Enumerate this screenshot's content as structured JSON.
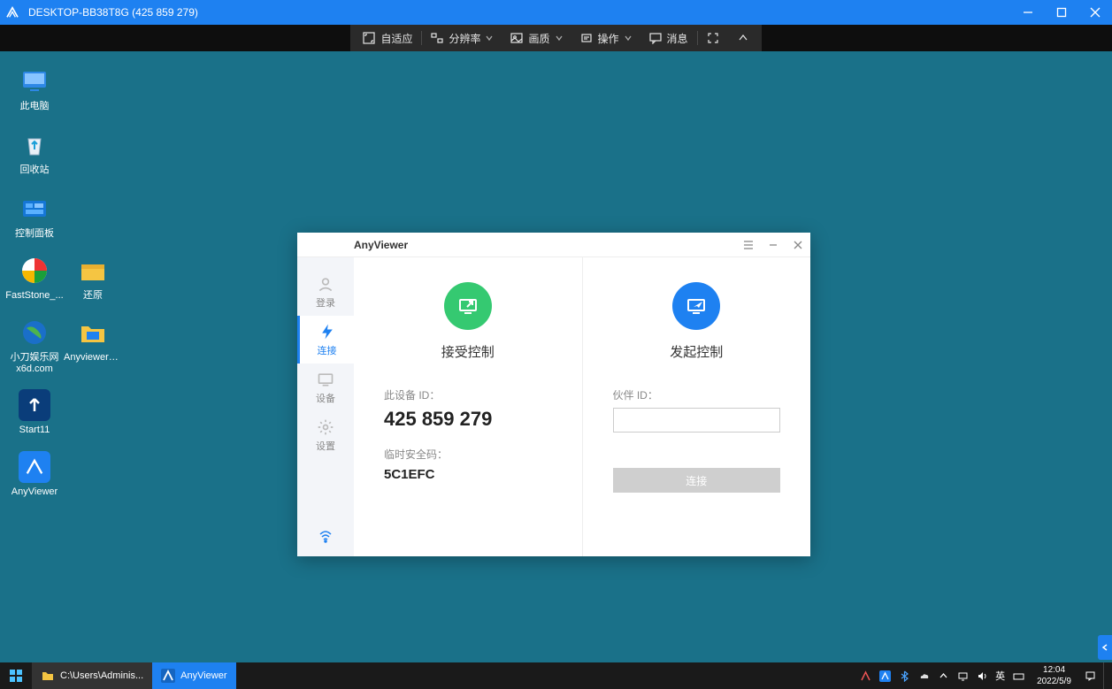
{
  "outer": {
    "title": "DESKTOP-BB38T8G (425 859 279)"
  },
  "toolbar": {
    "fit": "自适应",
    "resolution": "分辨率",
    "quality": "画质",
    "operate": "操作",
    "message": "消息"
  },
  "desktop_icons": [
    {
      "label": "此电脑"
    },
    {
      "label": "回收站"
    },
    {
      "label": "控制面板"
    },
    {
      "label": "FastStone_..."
    },
    {
      "label": "还原"
    },
    {
      "label": "小刀娱乐网x6d.com"
    },
    {
      "label": "Anyviewer_..."
    },
    {
      "label": "Start11"
    },
    {
      "label": "AnyViewer"
    }
  ],
  "av": {
    "brand": "AnyViewer",
    "sidebar": {
      "login": "登录",
      "connect": "连接",
      "device": "设备",
      "settings": "设置"
    },
    "accept": {
      "title": "接受控制",
      "device_id_label": "此设备 ID：",
      "device_id": "425 859 279",
      "sec_label": "临时安全码：",
      "sec_code": "5C1EFC"
    },
    "initiate": {
      "title": "发起控制",
      "partner_label": "伙伴 ID：",
      "connect_btn": "连接"
    }
  },
  "taskbar": {
    "explorer": "C:\\Users\\Adminis...",
    "anyviewer": "AnyViewer"
  },
  "tray": {
    "ime": "英",
    "time": "12:04",
    "date": "2022/5/9"
  }
}
